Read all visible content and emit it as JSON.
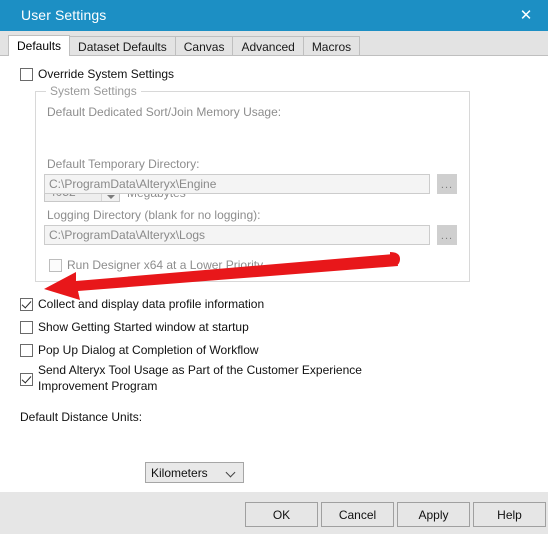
{
  "window": {
    "title": "User Settings",
    "close_icon": "close-icon",
    "titlebar_color": "#1c8fc4"
  },
  "tabs": [
    {
      "label": "Defaults",
      "selected": true
    },
    {
      "label": "Dataset Defaults",
      "selected": false
    },
    {
      "label": "Canvas",
      "selected": false
    },
    {
      "label": "Advanced",
      "selected": false
    },
    {
      "label": "Macros",
      "selected": false
    }
  ],
  "override": {
    "label": "Override System Settings",
    "checked": false
  },
  "system_settings": {
    "group_label": "System Settings",
    "memory": {
      "label": "Default Dedicated Sort/Join Memory Usage:",
      "value": "4052",
      "unit_label": "Megabytes",
      "up_icon": "spinner-up-icon",
      "down_icon": "spinner-down-icon"
    },
    "temp_dir": {
      "label": "Default Temporary Directory:",
      "value": "C:\\ProgramData\\Alteryx\\Engine",
      "browse_label": "..."
    },
    "log_dir": {
      "label": "Logging Directory (blank for no logging):",
      "value": "C:\\ProgramData\\Alteryx\\Logs",
      "browse_label": "..."
    },
    "lower_priority": {
      "label": "Run Designer x64 at a Lower Priority",
      "checked": false
    }
  },
  "options": [
    {
      "label": "Collect and display data profile information",
      "checked": true
    },
    {
      "label": "Show Getting Started window at startup",
      "checked": false
    },
    {
      "label": "Pop Up Dialog at Completion of Workflow",
      "checked": false
    },
    {
      "label": "Send Alteryx Tool Usage as Part of the Customer Experience Improvement Program",
      "checked": true
    }
  ],
  "distance_units": {
    "label": "Default Distance Units:",
    "value": "Kilometers",
    "chevron_icon": "chevron-down-icon"
  },
  "footer_buttons": [
    {
      "label": "OK"
    },
    {
      "label": "Cancel"
    },
    {
      "label": "Apply"
    },
    {
      "label": "Help"
    }
  ],
  "annotation": {
    "type": "arrow",
    "color": "#e8171a",
    "points_to": "Collect and display data profile information"
  }
}
